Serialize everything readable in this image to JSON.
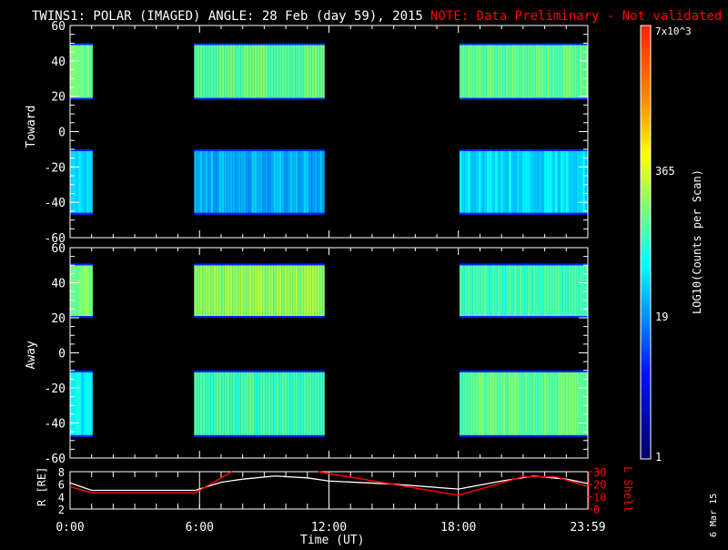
{
  "title": "TWINS1: POLAR (IMAGED) ANGLE: 28 Feb (day  59), 2015",
  "note": "NOTE: Data Preliminary - Not validated",
  "side_date": "6 Mar 15",
  "colors": {
    "white": "#ffffff",
    "red": "#ff0000",
    "background": "#000000"
  },
  "chart_data": {
    "type": "heatmap",
    "panels": [
      {
        "name": "Toward",
        "ylabel": "Toward",
        "ylim": [
          -60,
          60
        ],
        "yticks": [
          "60",
          "40",
          "20",
          "0",
          "-20",
          "-40",
          "-60"
        ],
        "blocks": [
          {
            "t": [
              0,
              1.05
            ],
            "bands": [
              {
                "a": [
                  18,
                  50
                ],
                "level": 0.55
              },
              {
                "a": [
                  -47,
                  -10
                ],
                "level": 0.5
              }
            ]
          },
          {
            "t": [
              5.75,
              11.8
            ],
            "bands": [
              {
                "a": [
                  18,
                  50
                ],
                "level": 0.55
              },
              {
                "a": [
                  -47,
                  -10
                ],
                "level": 0.45
              }
            ]
          },
          {
            "t": [
              18.05,
              24
            ],
            "bands": [
              {
                "a": [
                  18,
                  50
                ],
                "level": 0.55
              },
              {
                "a": [
                  -47,
                  -10
                ],
                "level": 0.42
              }
            ]
          }
        ]
      },
      {
        "name": "Away",
        "ylabel": "Away",
        "ylim": [
          -60,
          60
        ],
        "yticks": [
          "60",
          "40",
          "20",
          "0",
          "-20",
          "-40",
          "-60"
        ],
        "blocks": [
          {
            "t": [
              0,
              1.05
            ],
            "bands": [
              {
                "a": [
                  20,
                  51
                ],
                "level": 0.58
              },
              {
                "a": [
                  -48,
                  -10
                ],
                "level": 0.52
              }
            ]
          },
          {
            "t": [
              5.75,
              11.8
            ],
            "bands": [
              {
                "a": [
                  20,
                  51
                ],
                "level": 0.6
              },
              {
                "a": [
                  -48,
                  -10
                ],
                "level": 0.6
              }
            ]
          },
          {
            "t": [
              18.05,
              24
            ],
            "bands": [
              {
                "a": [
                  20,
                  51
                ],
                "level": 0.52
              },
              {
                "a": [
                  -48,
                  -10
                ],
                "level": 0.55
              }
            ]
          }
        ]
      }
    ],
    "colorbar": {
      "label": "LOG10(Counts per Scan)",
      "ticks": [
        "7x10^3",
        "365",
        "19",
        "1"
      ],
      "range": [
        1,
        7000
      ]
    },
    "orbit": {
      "ylabel_left": "R [RE]",
      "ylim_left": [
        2,
        8
      ],
      "yticks_left": [
        "8",
        "6",
        "4",
        "2"
      ],
      "ylabel_right": "L Shell",
      "ylim_right": [
        0,
        30
      ],
      "yticks_right": [
        "30",
        "20",
        "10",
        "0"
      ],
      "R": [
        [
          0,
          6.2
        ],
        [
          1,
          5
        ],
        [
          5.8,
          5
        ],
        [
          7,
          6.3
        ],
        [
          8,
          6.8
        ],
        [
          9.5,
          7.3
        ],
        [
          11,
          7
        ],
        [
          12,
          6.5
        ],
        [
          15,
          6
        ],
        [
          18,
          5.2
        ],
        [
          20,
          6.5
        ],
        [
          21.5,
          7.3
        ],
        [
          23,
          6.8
        ],
        [
          24,
          6.1
        ]
      ],
      "L": [
        [
          0,
          18
        ],
        [
          1,
          13
        ],
        [
          5.8,
          13
        ],
        [
          7.5,
          31
        ]
      ],
      "L2": [
        [
          11.5,
          31
        ],
        [
          18,
          11
        ],
        [
          21,
          26
        ],
        [
          22.5,
          26
        ],
        [
          24,
          18
        ]
      ]
    },
    "xlabel": "Time (UT)",
    "xticks": [
      {
        "h": 0,
        "label": "0:00"
      },
      {
        "h": 6,
        "label": "6:00"
      },
      {
        "h": 12,
        "label": "12:00"
      },
      {
        "h": 18,
        "label": "18:00"
      },
      {
        "h": 24,
        "label": "23:59"
      }
    ]
  }
}
